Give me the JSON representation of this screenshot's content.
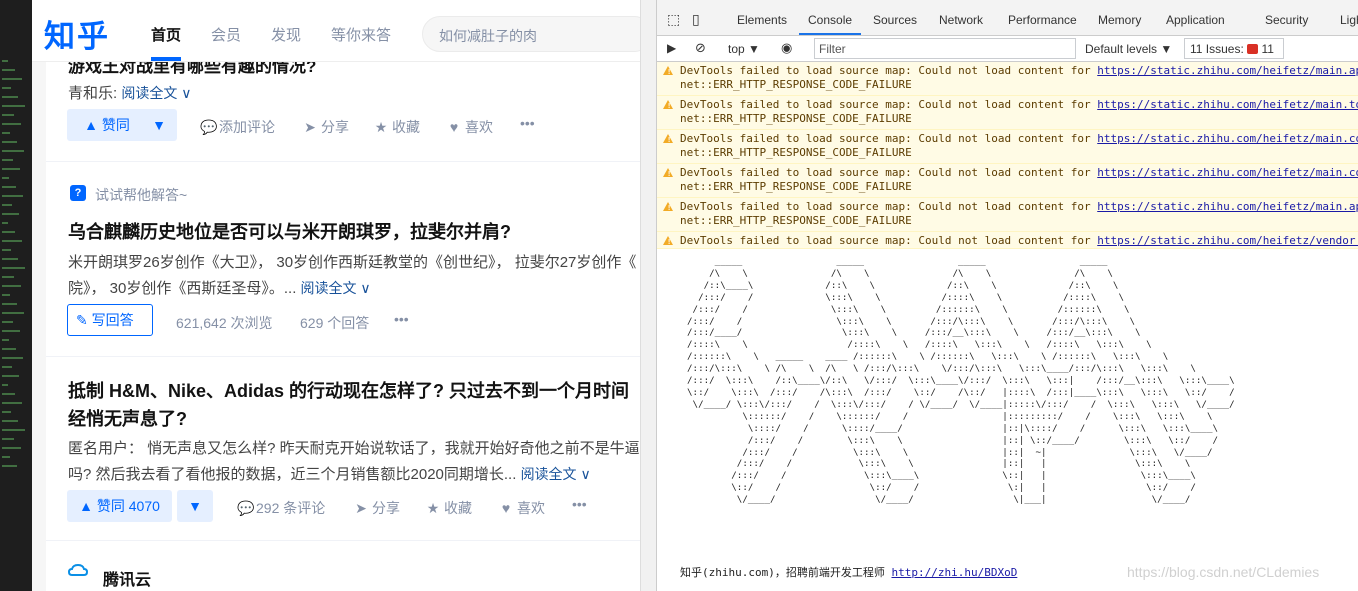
{
  "zhihu": {
    "logo": "知乎",
    "nav": [
      "首页",
      "会员",
      "发现",
      "等你来答"
    ],
    "search_placeholder": "如何减肚子的肉",
    "feed": {
      "item1": {
        "title_tail": "游戏王对战里有哪些有趣的情况?",
        "author": "青和乐:",
        "read_all": "阅读全文 ∨",
        "vote_label": "▲ 赞同",
        "actions": [
          "添加评论",
          "分享",
          "收藏",
          "喜欢"
        ]
      },
      "item2": {
        "hint": "试试帮他解答~",
        "title": "乌合麒麟历史地位是否可以与米开朗琪罗，拉斐尔并肩?",
        "excerpt_line1": "米开朗琪罗26岁创作《大卫》， 30岁创作西斯廷教堂的《创世纪》， 拉斐尔27岁创作《",
        "excerpt_line2": "院》， 30岁创作《西斯廷圣母》。...",
        "read_all": "阅读全文 ∨",
        "write_label": "写回答",
        "views": "621,642 次浏览",
        "answers": "629 个回答"
      },
      "item3": {
        "title_line1": "抵制 H&M、Nike、Adidas 的行动现在怎样了? 只过去不到一个月时间",
        "title_line2": "经悄无声息了?",
        "excerpt_line1": "匿名用户： 悄无声息又怎么样? 昨天耐克开始说软话了，我就开始好奇他之前不是牛逼",
        "excerpt_line2": "吗? 然后我去看了看他报的数据，近三个月销售额比2020同期增长...",
        "read_all": "阅读全文 ∨",
        "vote_label": "▲ 赞同 4070",
        "comments": "292 条评论",
        "actions": [
          "分享",
          "收藏",
          "喜欢"
        ]
      },
      "item4": {
        "source": "腾讯云"
      }
    }
  },
  "devtools": {
    "tabs": [
      "Elements",
      "Console",
      "Sources",
      "Network",
      "Performance",
      "Memory",
      "Application",
      "Security",
      "Lighth"
    ],
    "toolbar": {
      "context": "top ▼",
      "filter_placeholder": "Filter",
      "levels": "Default levels ▼",
      "issues": "11 Issues:",
      "issues_count": "11"
    },
    "warnings": [
      {
        "prefix": "DevTools failed to load source map: Could not load content for ",
        "url": "https://static.zhihu.com/heifetz/main.app",
        "cont": "net::ERR_HTTP_RESPONSE_CODE_FAILURE"
      },
      {
        "prefix": "DevTools failed to load source map: Could not load content for ",
        "url": "https://static.zhihu.com/heifetz/main.to",
        "cont": "net::ERR_HTTP_RESPONSE_CODE_FAILURE"
      },
      {
        "prefix": "DevTools failed to load source map: Could not load content for ",
        "url": "https://static.zhihu.com/heifetz/main.co",
        "cont": "net::ERR_HTTP_RESPONSE_CODE_FAILURE"
      },
      {
        "prefix": "DevTools failed to load source map: Could not load content for ",
        "url": "https://static.zhihu.com/heifetz/main.co",
        "cont": "net::ERR_HTTP_RESPONSE_CODE_FAILURE"
      },
      {
        "prefix": "DevTools failed to load source map: Could not load content for ",
        "url": "https://static.zhihu.com/heifetz/main.ap",
        "cont": "net::ERR_HTTP_RESPONSE_CODE_FAILURE"
      },
      {
        "prefix": "DevTools failed to load source map: Could not load content for ",
        "url": "https://static.zhihu.com/heifetz/vendor.",
        "cont": ""
      }
    ],
    "ascii_art": "     _____                 _____                 _____                 _____\n    /\\    \\               /\\    \\               /\\    \\               /\\    \\\n   /::\\____\\             /::\\    \\             /::\\    \\             /::\\    \\\n  /:::/    /             \\:::\\    \\           /::::\\    \\           /::::\\    \\\n /:::/    /               \\:::\\    \\         /::::::\\    \\         /::::::\\    \\\n/:::/    /                 \\:::\\    \\       /:::/\\:::\\    \\       /:::/\\:::\\    \\\n/:::/____/                  \\:::\\    \\     /:::/__\\:::\\    \\     /:::/__\\:::\\    \\\n/::::\\    \\                  /::::\\    \\   /::::\\   \\:::\\    \\   /::::\\   \\:::\\    \\\n/::::::\\    \\   _____    ____ /::::::\\    \\ /::::::\\   \\:::\\    \\ /::::::\\   \\:::\\    \\\n/:::/\\:::\\    \\ /\\    \\  /\\   \\ /:::/\\:::\\    \\/:::/\\:::\\   \\:::\\____/:::/\\:::\\   \\:::\\    \\\n/:::/  \\:::\\    /::\\____\\/::\\   \\/:::/  \\:::\\____\\/:::/  \\:::\\   \\:::|    /:::/__\\:::\\   \\:::\\____\\\n\\::/    \\:::\\  /:::/    /\\:::\\  /:::/    \\::/    /\\::/   |::::\\  /:::|____\\:::\\   \\:::\\   \\::/    /\n \\/____/ \\:::\\/:::/    /  \\:::\\/:::/    / \\/____/  \\/____|:::::\\/:::/    /  \\:::\\   \\:::\\   \\/____/\n          \\::::::/    /    \\::::::/    /                 |:::::::::/    /    \\:::\\   \\:::\\    \\\n           \\::::/    /      \\::::/____/                  |::|\\::::/    /      \\:::\\   \\:::\\____\\\n           /:::/    /        \\:::\\    \\                  |::| \\::/____/        \\:::\\   \\::/    /\n          /:::/    /          \\:::\\    \\                 |::|  ~|               \\:::\\   \\/____/\n         /:::/    /            \\:::\\    \\                |::|   |                \\:::\\    \\\n        /:::/    /              \\:::\\____\\               \\::|   |                 \\:::\\____\\\n        \\::/    /                \\::/    /                \\:|   |                  \\::/    /\n         \\/____/                  \\/____/                  \\|___|                   \\/____/",
    "footer_text": "知乎(zhihu.com)，招聘前端开发工程师 ",
    "footer_url": "http://zhi.hu/BDXoD",
    "watermark": "https://blog.csdn.net/CLdemies"
  }
}
